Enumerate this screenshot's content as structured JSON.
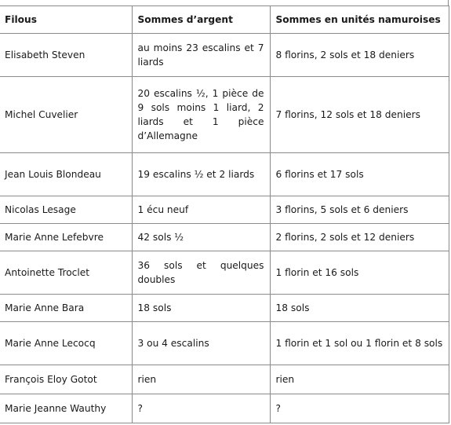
{
  "table": {
    "headers": [
      "Filous",
      "Sommes d’argent",
      "Sommes en unités namuroises"
    ],
    "rows": [
      {
        "name": "Elisabeth Steven",
        "argent": "au moins 23 escalins et 7 liards",
        "namur": "8 florins, 2 sols et 18 deniers"
      },
      {
        "name": "Michel Cuvelier",
        "argent": "20 escalins ½, 1 pièce de 9 sols moins 1 liard, 2 liards et 1 pièce d’Allemagne",
        "namur": "7 florins, 12 sols et 18 deniers"
      },
      {
        "name": "Jean Louis Blondeau",
        "argent": "19 escalins ½ et 2 liards",
        "namur": "6 florins et 17 sols"
      },
      {
        "name": "Nicolas Lesage",
        "argent": "1 écu neuf",
        "namur": "3 florins, 5 sols et 6 deniers"
      },
      {
        "name": "Marie Anne Lefebvre",
        "argent": "42 sols ½",
        "namur": "2 florins, 2 sols et 12 deniers"
      },
      {
        "name": "Antoinette Troclet",
        "argent": "36 sols et quelques doubles",
        "namur": "1 florin et 16 sols"
      },
      {
        "name": "Marie Anne Bara",
        "argent": "18 sols",
        "namur": "18 sols"
      },
      {
        "name": "Marie Anne Lecocq",
        "argent": "3 ou 4 escalins",
        "namur": "1 florin et 1 sol ou 1 florin et 8 sols"
      },
      {
        "name": "François Eloy Gotot",
        "argent": "rien",
        "namur": "rien"
      },
      {
        "name": "Marie Jeanne Wauthy",
        "argent": "?",
        "namur": "?"
      }
    ]
  }
}
